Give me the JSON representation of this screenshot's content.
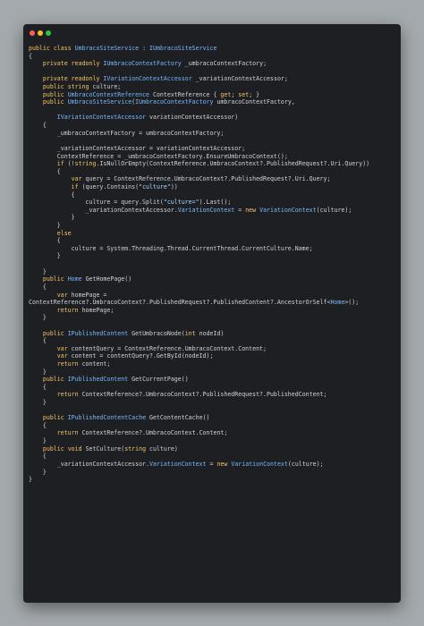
{
  "window": {
    "controls": [
      "close",
      "minimize",
      "maximize"
    ]
  },
  "code_lines": [
    "public class UmbracoSiteService : IUmbracoSiteService",
    "{",
    "    private readonly IUmbracoContextFactory _umbracoContextFactory;",
    "",
    "    private readonly IVariationContextAccessor _variationContextAccessor;",
    "    public string culture;",
    "    public UmbracoContextReference ContextReference { get; set; }",
    "    public UmbracoSiteService(IUmbracoContextFactory umbracoContextFactory,",
    "",
    "        IVariationContextAccessor variationContextAccessor)",
    "    {",
    "        _umbracoContextFactory = umbracoContextFactory;",
    "",
    "        _variationContextAccessor = variationContextAccessor;",
    "        ContextReference = _umbracoContextFactory.EnsureUmbracoContext();",
    "        if (!string.IsNullOrEmpty(ContextReference.UmbracoContext?.PublishedRequest?.Uri.Query))",
    "        {",
    "            var query = ContextReference.UmbracoContext?.PublishedRequest?.Uri.Query;",
    "            if (query.Contains(\"culture\"))",
    "            {",
    "                culture = query.Split(\"culture=\").Last();",
    "                _variationContextAccessor.VariationContext = new VariationContext(culture);",
    "            }",
    "        }",
    "        else",
    "        {",
    "            culture = System.Threading.Thread.CurrentThread.CurrentCulture.Name;",
    "        }",
    "",
    "    }",
    "    public Home GetHomePage()",
    "    {",
    "        var homePage =",
    "ContextReference?.UmbracoContext?.PublishedRequest?.PublishedContent?.AncestorOrSelf<Home>();",
    "        return homePage;",
    "    }",
    "",
    "    public IPublishedContent GetUmbracoNode(int nodeId)",
    "    {",
    "        var contentQuery = ContextReference.UmbracoContext.Content;",
    "        var content = contentQuery?.GetById(nodeId);",
    "        return content;",
    "    }",
    "    public IPublishedContent GetCurrentPage()",
    "    {",
    "        return ContextReference?.UmbracoContext?.PublishedRequest?.PublishedContent;",
    "    }",
    "",
    "    public IPublishedContentCache GetContentCache()",
    "    {",
    "        return ContextReference?.UmbracoContext.Content;",
    "    }",
    "    public void SetCulture(string culture)",
    "    {",
    "        _variationContextAccessor.VariationContext = new VariationContext(culture);",
    "    }",
    "}"
  ]
}
